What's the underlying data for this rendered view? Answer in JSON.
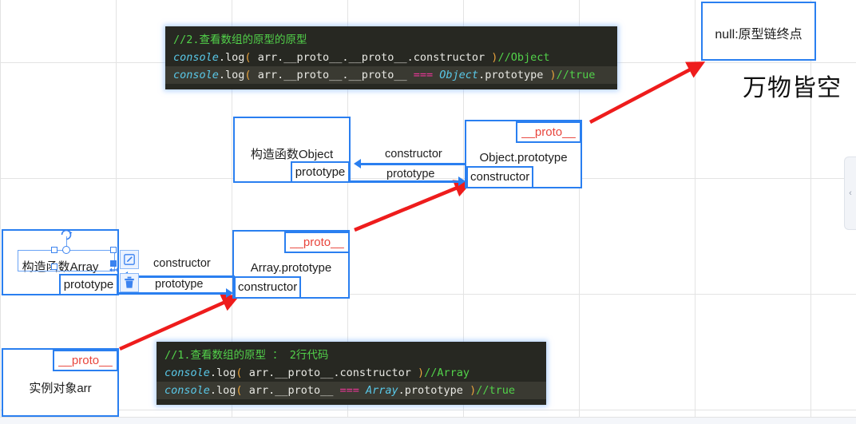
{
  "canvas": {
    "background": "#ffffff",
    "grid_color": "#e3e3e3",
    "accent_blue": "#2a7ff0",
    "proto_red": "#e8453c",
    "arrow_red": "#ee1c1c"
  },
  "code_blocks": [
    {
      "id": "code-top",
      "comment": "//2.查看数组的原型的原型",
      "lines": [
        {
          "obj": "console",
          "dot_log": ".log",
          "open": "(",
          "expr": " arr.__proto__.__proto__.constructor ",
          "close": ")",
          "result": "//Object"
        },
        {
          "obj": "console",
          "dot_log": ".log",
          "open": "(",
          "expr_a": " arr.__proto__.__proto__ ",
          "eq": "===",
          "expr_b_obj": "Object",
          "expr_b_rest": ".prototype ",
          "close": ")",
          "result": "//true"
        }
      ]
    },
    {
      "id": "code-bottom",
      "comment": "//1.查看数组的原型 ： 2行代码",
      "lines": [
        {
          "obj": "console",
          "dot_log": ".log",
          "open": "(",
          "expr": " arr.__proto__.constructor ",
          "close": ")",
          "result": "//Array"
        },
        {
          "obj": "console",
          "dot_log": ".log",
          "open": "(",
          "expr_a": " arr.__proto__ ",
          "eq": "===",
          "expr_b_obj": "Array",
          "expr_b_rest": ".prototype ",
          "close": ")",
          "result": "//true"
        }
      ]
    }
  ],
  "nodes": {
    "null_box": {
      "label": "null:原型链终点"
    },
    "ctor_object": {
      "title": "构造函数Object",
      "slot_prototype": "prototype"
    },
    "object_prototype": {
      "title": "Object.prototype",
      "slot_proto": "__proto__",
      "slot_constructor": "constructor"
    },
    "ctor_array": {
      "title": "构造函数Array",
      "slot_prototype": "prototype"
    },
    "array_prototype": {
      "title": "Array.prototype",
      "slot_proto": "__proto__",
      "slot_constructor": "constructor"
    },
    "instance_arr": {
      "title": "实例对象arr",
      "slot_proto": "__proto__"
    }
  },
  "edge_labels": {
    "object_constructor": "constructor",
    "object_prototype": "prototype",
    "array_constructor": "constructor",
    "array_prototype": "prototype"
  },
  "free_text": {
    "slogan": "万物皆空"
  },
  "toolbar": {
    "edit_label": "edit-shape",
    "delete_label": "delete-shape"
  },
  "collapse": {
    "glyph": "‹"
  }
}
